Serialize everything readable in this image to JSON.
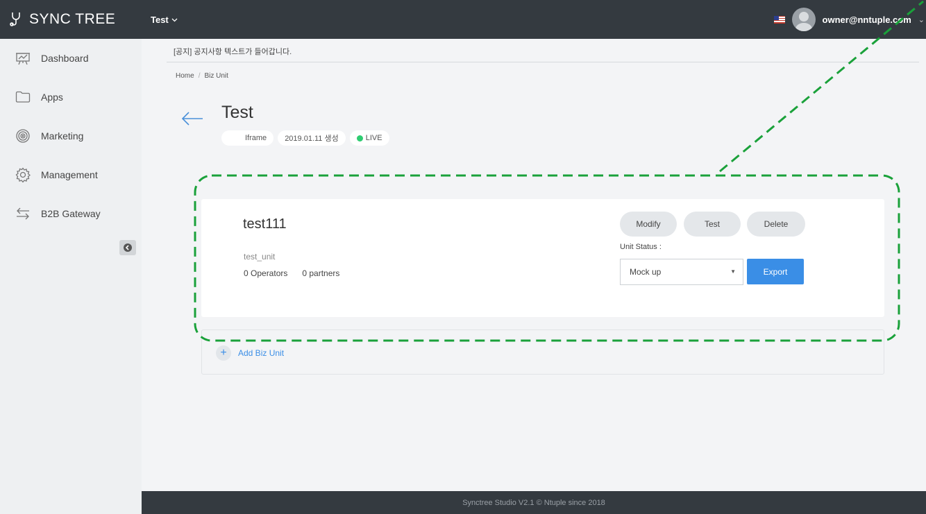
{
  "app": {
    "logo_text": "SYNC TREE",
    "project_name": "Test",
    "user_email": "owner@nntuple.com"
  },
  "sidebar": {
    "items": [
      {
        "label": "Dashboard",
        "icon": "dashboard-icon"
      },
      {
        "label": "Apps",
        "icon": "folder-icon"
      },
      {
        "label": "Marketing",
        "icon": "target-icon"
      },
      {
        "label": "Management",
        "icon": "gear-icon"
      },
      {
        "label": "B2B Gateway",
        "icon": "exchange-icon"
      }
    ]
  },
  "notice": "[공지] 공지사항 텍스트가 들어갑니다.",
  "breadcrumb": {
    "home": "Home",
    "separator": "/",
    "current": "Biz Unit"
  },
  "page": {
    "title": "Test",
    "chip_type": "Iframe",
    "chip_created": "2019.01.11 생성",
    "chip_status": "LIVE"
  },
  "unit": {
    "name": "test111",
    "id": "test_unit",
    "operators": "0 Operators",
    "partners": "0 partners",
    "modify_label": "Modify",
    "test_label": "Test",
    "delete_label": "Delete",
    "status_label": "Unit Status :",
    "status_value": "Mock up",
    "export_label": "Export"
  },
  "add_unit_label": "Add Biz Unit",
  "footer": "Synctree Studio V2.1 © Ntuple since 2018",
  "colors": {
    "topbar": "#343a40",
    "accent_blue": "#3a8ee6",
    "live_green": "#2ecc71",
    "annotation_green": "#1aa13a"
  }
}
